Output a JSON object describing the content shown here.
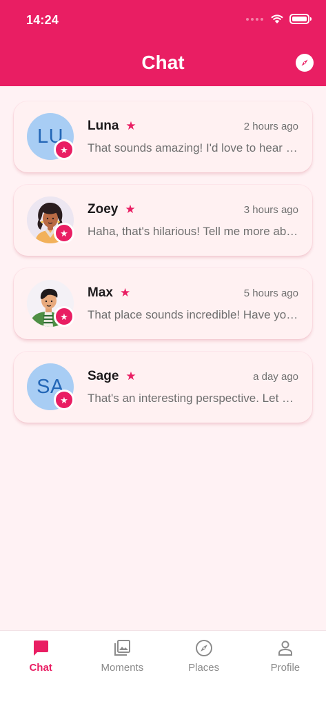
{
  "status_bar": {
    "time": "14:24"
  },
  "header": {
    "title": "Chat"
  },
  "chats": [
    {
      "initials": "LU",
      "name": "Luna",
      "star": "★",
      "time": "2 hours ago",
      "preview": "That sounds amazing! I'd love to hear more about it"
    },
    {
      "initials": "",
      "name": "Zoey",
      "star": "★",
      "time": "3 hours ago",
      "preview": "Haha, that's hilarious! Tell me more about it"
    },
    {
      "initials": "",
      "name": "Max",
      "star": "★",
      "time": "5 hours ago",
      "preview": "That place sounds incredible! Have you been there"
    },
    {
      "initials": "SA",
      "name": "Sage",
      "star": "★",
      "time": "a day ago",
      "preview": "That's an interesting perspective. Let me think"
    }
  ],
  "badge_icon": "★",
  "bottom_nav": [
    {
      "label": "Chat",
      "icon": "chat-bubble-icon",
      "active": true
    },
    {
      "label": "Moments",
      "icon": "photo-library-icon",
      "active": false
    },
    {
      "label": "Places",
      "icon": "compass-icon",
      "active": false
    },
    {
      "label": "Profile",
      "icon": "person-icon",
      "active": false
    }
  ],
  "colors": {
    "primary": "#e91e63",
    "background": "#fff2f4",
    "inactive": "#8b8b8b"
  }
}
